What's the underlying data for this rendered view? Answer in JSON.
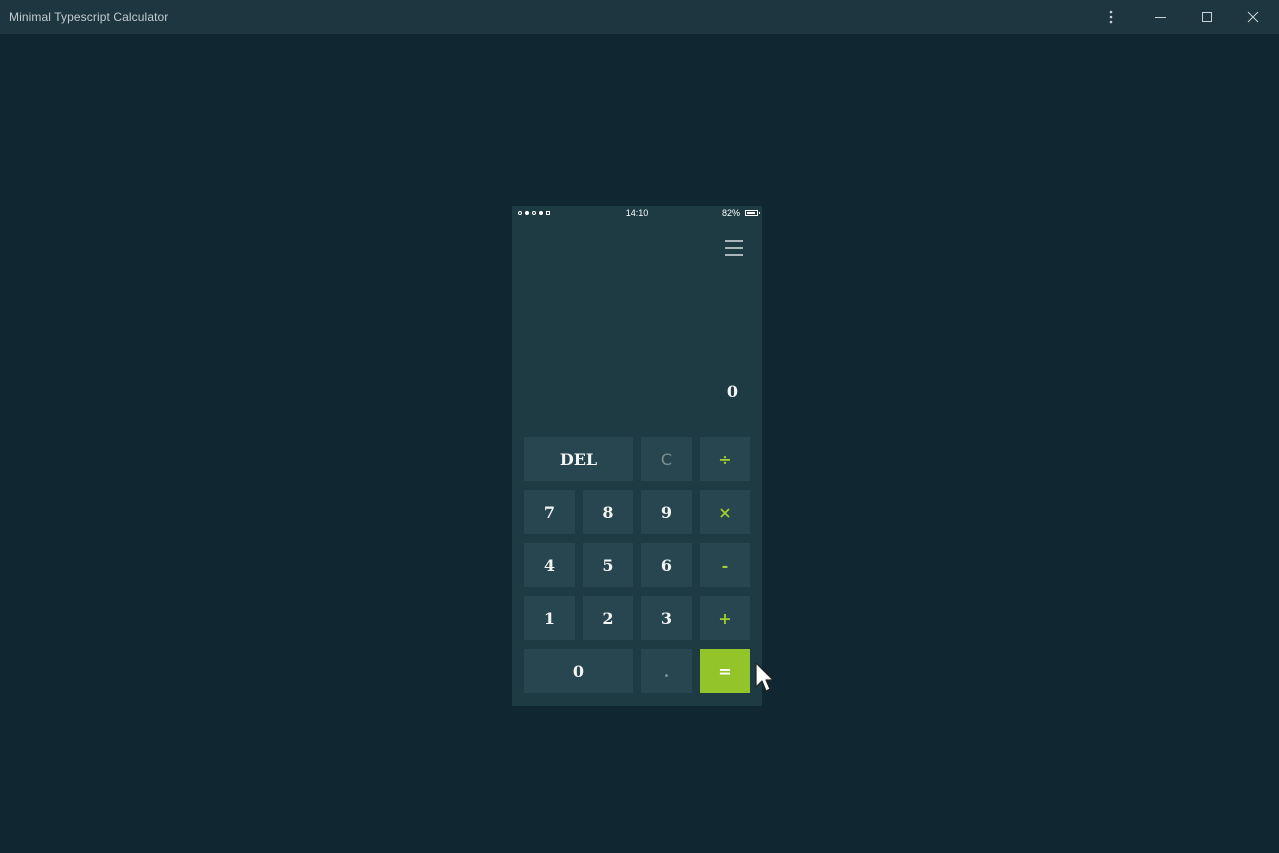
{
  "window": {
    "title": "Minimal Typescript Calculator",
    "controls": {
      "more": "more-options",
      "minimize": "minimize",
      "maximize": "maximize",
      "close": "close"
    }
  },
  "status_bar": {
    "time": "14:10",
    "battery": "82%"
  },
  "display": {
    "value": "0"
  },
  "keypad": {
    "del": "DEL",
    "clear": "C",
    "divide": "÷",
    "seven": "7",
    "eight": "8",
    "nine": "9",
    "multiply": "×",
    "four": "4",
    "five": "5",
    "six": "6",
    "minus": "-",
    "one": "1",
    "two": "2",
    "three": "3",
    "plus": "+",
    "zero": "0",
    "dot": ".",
    "equals": "="
  },
  "colors": {
    "background": "#102731",
    "titlebar": "#1e3640",
    "phone": "#1e3a43",
    "key": "#274650",
    "accent": "#93c52a",
    "operator_text": "#a3cf2e"
  }
}
